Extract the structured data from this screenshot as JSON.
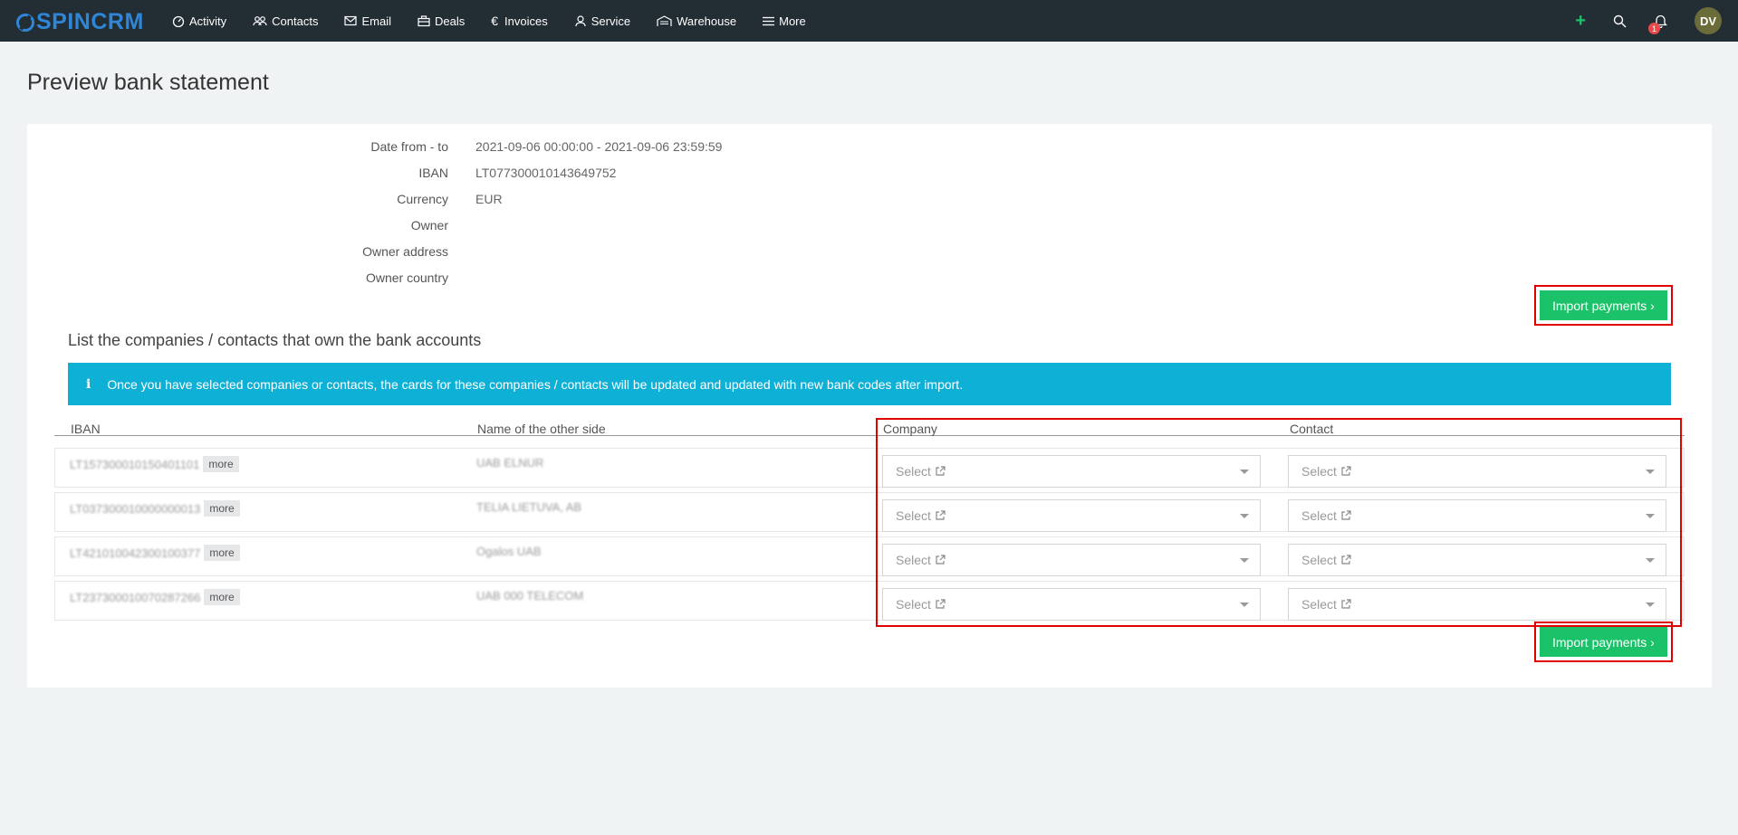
{
  "brand": {
    "logo_text": "SPINCRM"
  },
  "nav": [
    {
      "label": "Activity",
      "icon": "gauge-icon"
    },
    {
      "label": "Contacts",
      "icon": "people-icon"
    },
    {
      "label": "Email",
      "icon": "envelope-icon"
    },
    {
      "label": "Deals",
      "icon": "briefcase-icon"
    },
    {
      "label": "Invoices",
      "icon": "euro-icon"
    },
    {
      "label": "Service",
      "icon": "support-icon"
    },
    {
      "label": "Warehouse",
      "icon": "warehouse-icon"
    },
    {
      "label": "More",
      "icon": "menu-icon"
    }
  ],
  "topbar": {
    "plus": "+",
    "notifications_count": "1",
    "avatar_initials": "DV"
  },
  "page": {
    "title": "Preview bank statement"
  },
  "statement": {
    "rows": [
      {
        "label": "Date from - to",
        "value": "2021-09-06 00:00:00 - 2021-09-06 23:59:59"
      },
      {
        "label": "IBAN",
        "value": "LT077300010143649752"
      },
      {
        "label": "Currency",
        "value": "EUR"
      },
      {
        "label": "Owner",
        "value": ""
      },
      {
        "label": "Owner address",
        "value": ""
      },
      {
        "label": "Owner country",
        "value": ""
      }
    ]
  },
  "actions": {
    "import_label": "Import payments ›"
  },
  "accounts": {
    "title": "List the companies / contacts that own the bank accounts",
    "alert": "Once you have selected companies or contacts, the cards for these companies / contacts will be updated and updated with new bank codes after import.",
    "columns": {
      "iban": "IBAN",
      "name": "Name of the other side",
      "company": "Company",
      "contact": "Contact"
    },
    "more_label": "more",
    "select_placeholder": "Select",
    "rows": [
      {
        "iban": "LT157300010150401101",
        "name": "UAB ELNUR"
      },
      {
        "iban": "LT037300010000000013",
        "name": "TELIA LIETUVA, AB"
      },
      {
        "iban": "LT421010042300100377",
        "name": "Ogalos UAB"
      },
      {
        "iban": "LT237300010070287266",
        "name": "UAB 000 TELECOM"
      }
    ]
  }
}
